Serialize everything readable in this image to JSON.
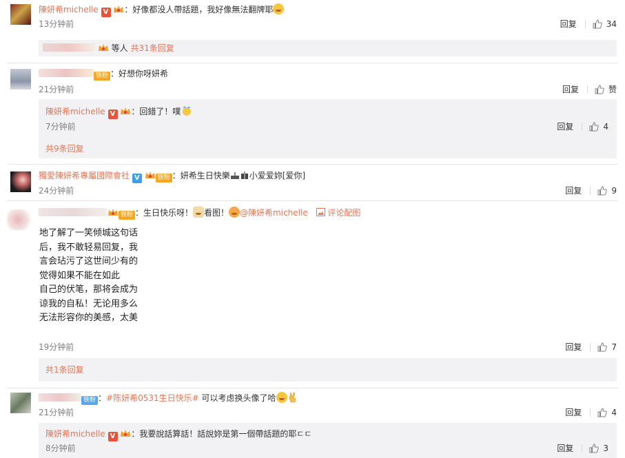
{
  "colors": {
    "link": "#eb7350",
    "muted": "#808080",
    "reply_box": "#f2f2f5",
    "verified_red": "#e8543b",
    "verified_blue": "#3c9fe8"
  },
  "comments": [
    {
      "user": "陳妍希michelle",
      "text": "：好像都没人帶話題，我好像無法翻牌耶",
      "time": "13分钟前",
      "reply_label": "回复",
      "likes": "34",
      "sub_summary": {
        "text": "等人",
        "count_link": "共31条回复"
      }
    },
    {
      "text": "：好想你呀妍希",
      "time": "21分钟前",
      "reply_label": "回复",
      "likes": "赞",
      "fan_badge": "铁粉",
      "reply": {
        "user": "陳妍希michelle",
        "text": "：回錯了！噗",
        "time": "7分钟前",
        "reply_label": "回复",
        "likes": "4"
      },
      "more_link": "共9条回复"
    },
    {
      "user": "獨愛陳妍希專屬國際會社",
      "text": "：妍希生日快樂",
      "text2": "小爱爱妳[爱你]",
      "time": "24分钟前",
      "reply_label": "回复",
      "likes": "9",
      "fan_badge": "铁粉"
    },
    {
      "text": "：生日快乐呀！",
      "text2": "看图！",
      "mention": "@陳妍希michelle",
      "comment_pic": "评论配图",
      "fan_badge": "铁粉",
      "time": "19分钟前",
      "reply_label": "回复",
      "likes": "7",
      "letter_lines": [
        "深地了解了一笑倾城这句话",
        "之后，我不敢轻易回复，我",
        "语言会玷污了这世间少有的",
        "！觉得如果不能在如此",
        "下自己的伏笔，那将会成为",
        "原谅我的自私！无论用多么",
        "是无法形容你的美感，太美"
      ],
      "more_link": "共1条回复"
    },
    {
      "text": "：",
      "hashtag": "#陈妍希0531生日快乐#",
      "text2": " 可以考虑换头像了哈",
      "fan_badge": "铁粉",
      "time": "21分钟前",
      "reply_label": "回复",
      "likes": "4",
      "reply": {
        "user": "陳妍希michelle",
        "text": "：我要說話算話！話說妳是第一個帶話題的耶ㄷㄷ",
        "time": "8分钟前",
        "reply_label": "回复",
        "likes": "3"
      }
    }
  ]
}
